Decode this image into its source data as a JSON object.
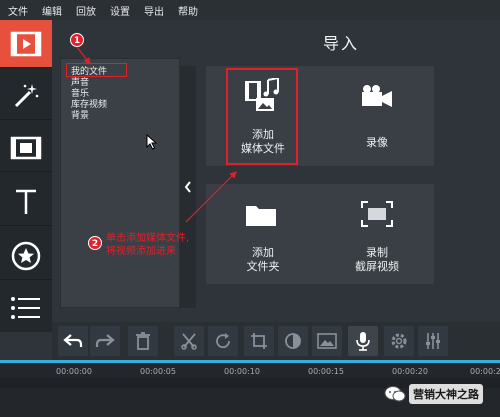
{
  "menu": [
    "文件",
    "编辑",
    "回放",
    "设置",
    "导出",
    "帮助"
  ],
  "panel": {
    "title": "导入"
  },
  "file_list": [
    "我的文件",
    "声音",
    "音乐",
    "库存视频",
    "背景"
  ],
  "tiles": {
    "add_media": {
      "line1": "添加",
      "line2": "媒体文件"
    },
    "record_video": {
      "label": "录像"
    },
    "add_folder": {
      "line1": "添加",
      "line2": "文件夹"
    },
    "record_screen": {
      "line1": "录制",
      "line2": "截屏视频"
    }
  },
  "annotations": {
    "step1": "1",
    "step2": "2",
    "text_line1": "单击添加媒体文件,",
    "text_line2": "将视频添加进来"
  },
  "timeline": {
    "ticks": [
      "00:00:00",
      "00:00:05",
      "00:00:10",
      "00:00:15",
      "00:00:20",
      "00:00:25"
    ]
  },
  "watermark": "营销大神之路",
  "colors": {
    "accent": "#e8503e",
    "annotation": "#e0202a",
    "timeline": "#3bb0e0"
  }
}
